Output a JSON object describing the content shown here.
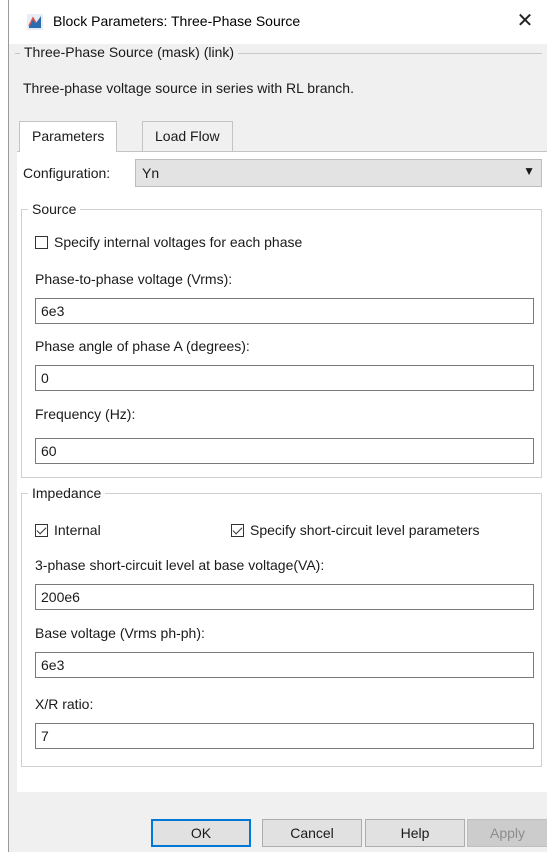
{
  "window": {
    "title": "Block Parameters: Three-Phase Source",
    "close_glyph": "✕"
  },
  "mask": {
    "title": "Three-Phase Source (mask) (link)",
    "description": "Three-phase voltage source in series with RL branch."
  },
  "tabs": [
    {
      "label": "Parameters"
    },
    {
      "label": "Load Flow"
    }
  ],
  "configuration": {
    "label": "Configuration:",
    "value": "Yn"
  },
  "source": {
    "legend": "Source",
    "specify_internal": {
      "label": "Specify internal voltages for each phase",
      "checked": false
    },
    "phase_voltage": {
      "label": "Phase-to-phase voltage (Vrms):",
      "value": "6e3"
    },
    "phase_angle": {
      "label": "Phase angle of phase A (degrees):",
      "value": "0"
    },
    "frequency": {
      "label": "Frequency (Hz):",
      "value": "60"
    }
  },
  "impedance": {
    "legend": "Impedance",
    "internal": {
      "label": "Internal",
      "checked": true
    },
    "specify_sc": {
      "label": "Specify short-circuit level parameters",
      "checked": true
    },
    "sc_level": {
      "label": "3-phase short-circuit level at base voltage(VA):",
      "value": "200e6"
    },
    "base_voltage": {
      "label": "Base voltage (Vrms ph-ph):",
      "value": "6e3"
    },
    "xr_ratio": {
      "label": "X/R ratio:",
      "value": "7"
    }
  },
  "buttons": {
    "ok": "OK",
    "cancel": "Cancel",
    "help": "Help",
    "apply": "Apply"
  },
  "icons": {
    "app": "simulink-block-icon",
    "dropdown": "chevron-down-icon"
  }
}
